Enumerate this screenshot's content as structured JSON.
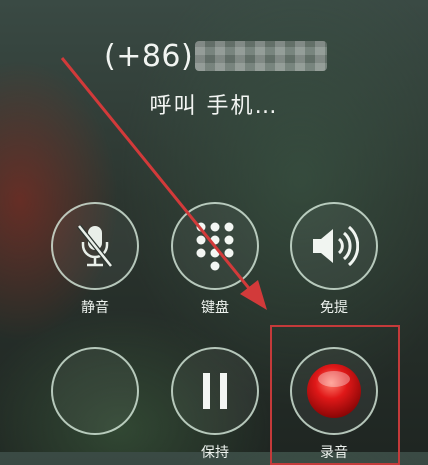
{
  "call": {
    "country_code": "(+86)",
    "status": "呼叫 手机…"
  },
  "buttons": {
    "mute_label": "静音",
    "keypad_label": "键盘",
    "speaker_label": "免提",
    "blank_label": "",
    "hold_label": "保持",
    "record_label": "录音"
  },
  "colors": {
    "annotation_red": "#d23a3a",
    "record_red": "#e01818"
  },
  "icons": {
    "mute": "microphone-slash-icon",
    "keypad": "keypad-grid-icon",
    "speaker": "speaker-icon",
    "hold": "pause-icon",
    "record": "record-dot-icon"
  }
}
